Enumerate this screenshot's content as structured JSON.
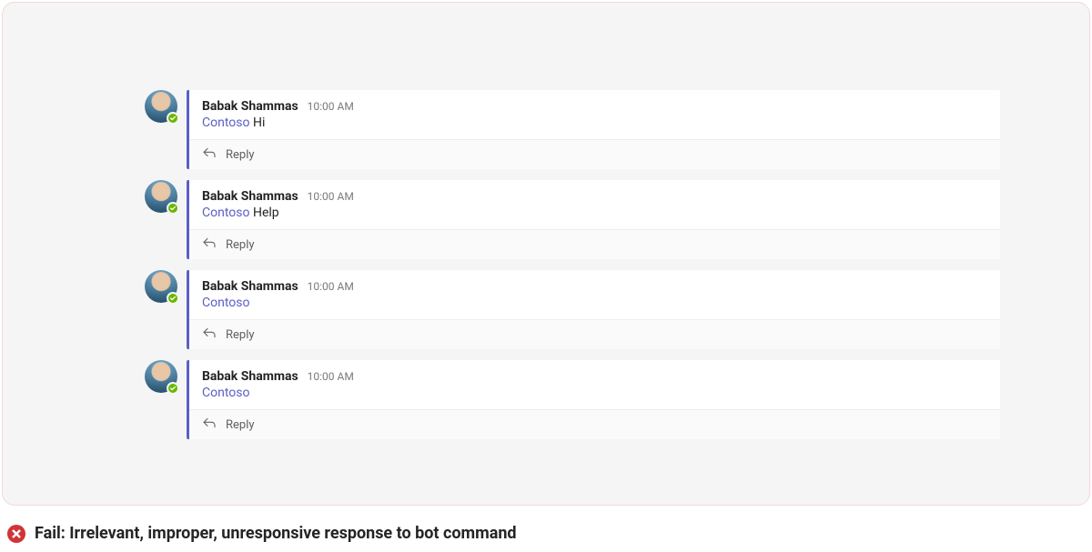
{
  "reply_label": "Reply",
  "posts": [
    {
      "author": "Babak Shammas",
      "time": "10:00 AM",
      "mention": "Contoso",
      "text": "Hi"
    },
    {
      "author": "Babak Shammas",
      "time": "10:00 AM",
      "mention": "Contoso",
      "text": "Help"
    },
    {
      "author": "Babak Shammas",
      "time": "10:00 AM",
      "mention": "Contoso",
      "text": ""
    },
    {
      "author": "Babak Shammas",
      "time": "10:00 AM",
      "mention": "Contoso",
      "text": ""
    }
  ],
  "status": {
    "text": "Fail: Irrelevant, improper, unresponsive response to bot command"
  }
}
